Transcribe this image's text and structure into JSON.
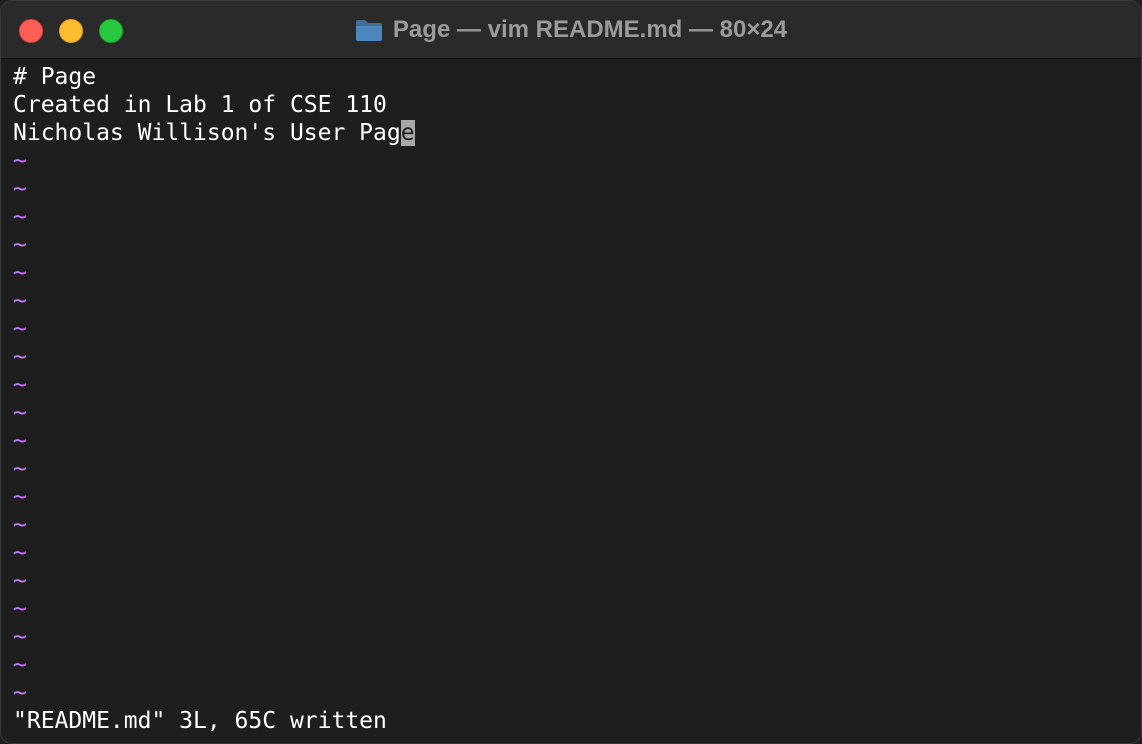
{
  "window": {
    "title": "Page — vim README.md — 80×24",
    "icon": "folder-icon"
  },
  "buffer": {
    "lines": [
      "# Page",
      "Created in Lab 1 of CSE 110",
      "Nicholas Willison's User Pag"
    ],
    "cursor_char": "e",
    "empty_line_marker": "~"
  },
  "status": {
    "message": "\"README.md\" 3L, 65C written"
  },
  "colors": {
    "background": "#1e1e1e",
    "text": "#ffffff",
    "tilde": "#c678ff",
    "cursor": "#a8a8a8",
    "close": "#ff5f57",
    "minimize": "#febc2e",
    "zoom": "#28c840"
  }
}
